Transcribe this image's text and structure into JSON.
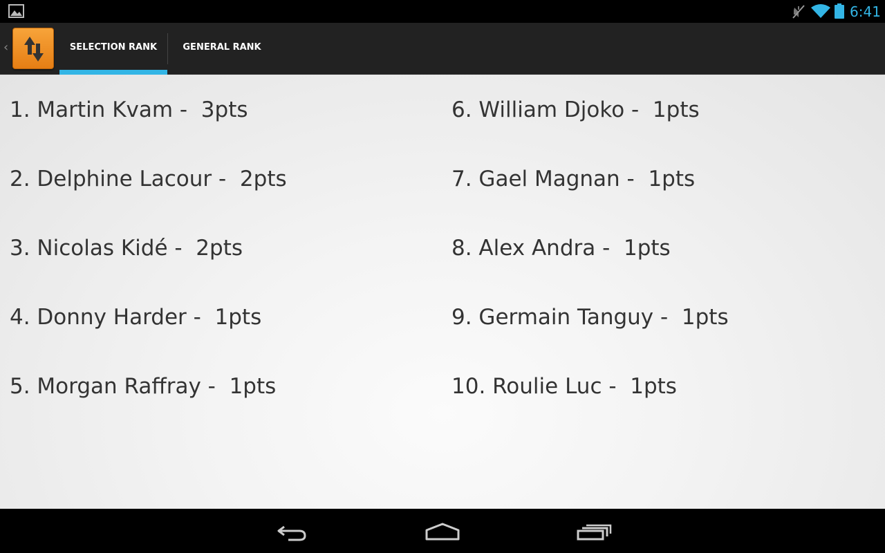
{
  "status_bar": {
    "time": "6:41",
    "icons": [
      "gallery-icon",
      "mute-icon",
      "wifi-icon",
      "battery-icon"
    ],
    "accent_color": "#33b5e5"
  },
  "action_bar": {
    "app_icon": "sort-arrows-icon",
    "tabs": [
      {
        "label": "SELECTION RANK",
        "selected": true
      },
      {
        "label": "GENERAL RANK",
        "selected": false
      }
    ],
    "indicator_color": "#33b5e5"
  },
  "ranking": {
    "items": [
      "1. Martin Kvam -  3pts",
      "2. Delphine Lacour -  2pts",
      "3. Nicolas Kidé -  2pts",
      "4. Donny Harder -  1pts",
      "5. Morgan Raffray -  1pts",
      "6. William Djoko -  1pts",
      "7. Gael Magnan -  1pts",
      "8. Alex Andra -  1pts",
      "9. Germain Tanguy -  1pts",
      "10. Roulie Luc -  1pts"
    ]
  },
  "nav_bar": {
    "buttons": [
      "back-icon",
      "home-icon",
      "recent-apps-icon"
    ]
  }
}
